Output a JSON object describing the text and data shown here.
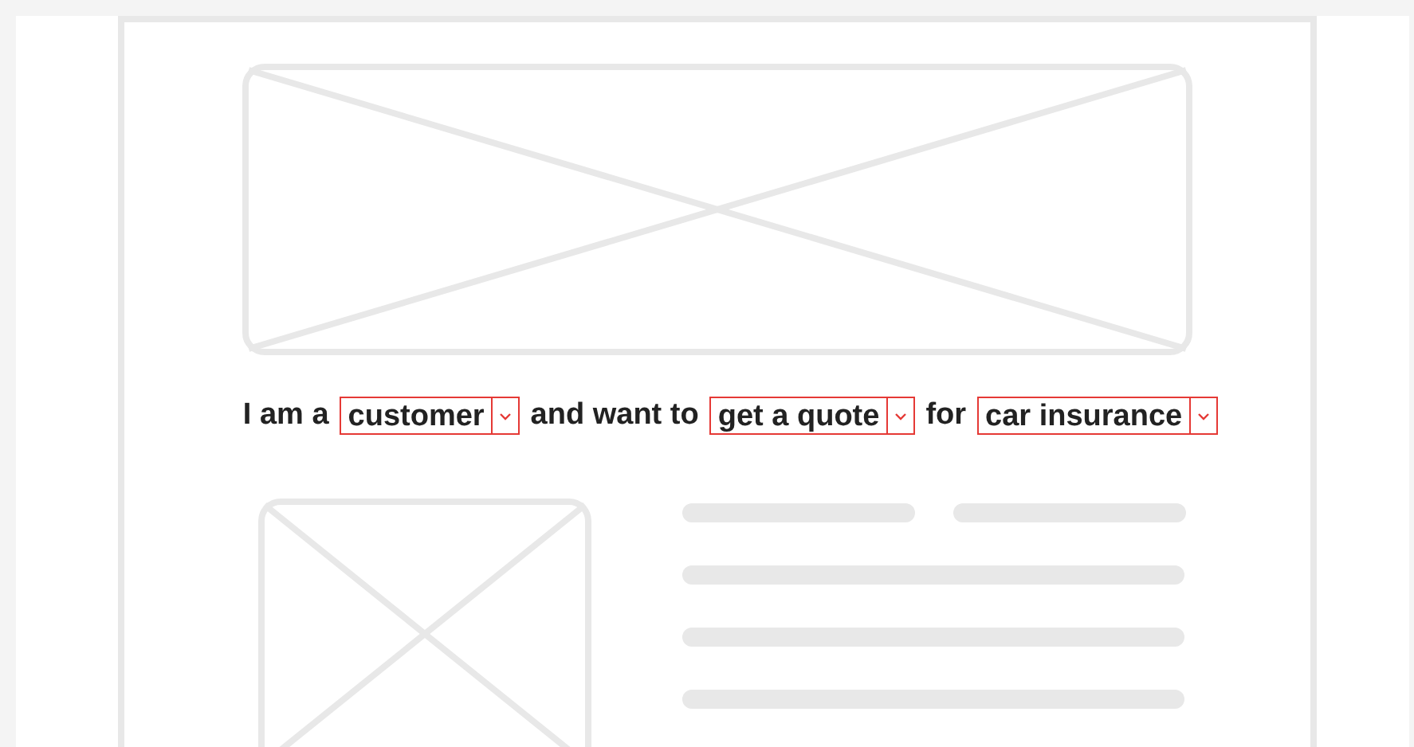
{
  "sentence": [
    {
      "kind": "text",
      "text": "I am a"
    },
    {
      "kind": "dropdown",
      "value": "customer"
    },
    {
      "kind": "text",
      "text": "and want to"
    },
    {
      "kind": "dropdown",
      "value": "get a quote"
    },
    {
      "kind": "text",
      "text": "for"
    },
    {
      "kind": "dropdown",
      "value": "car insurance"
    }
  ]
}
